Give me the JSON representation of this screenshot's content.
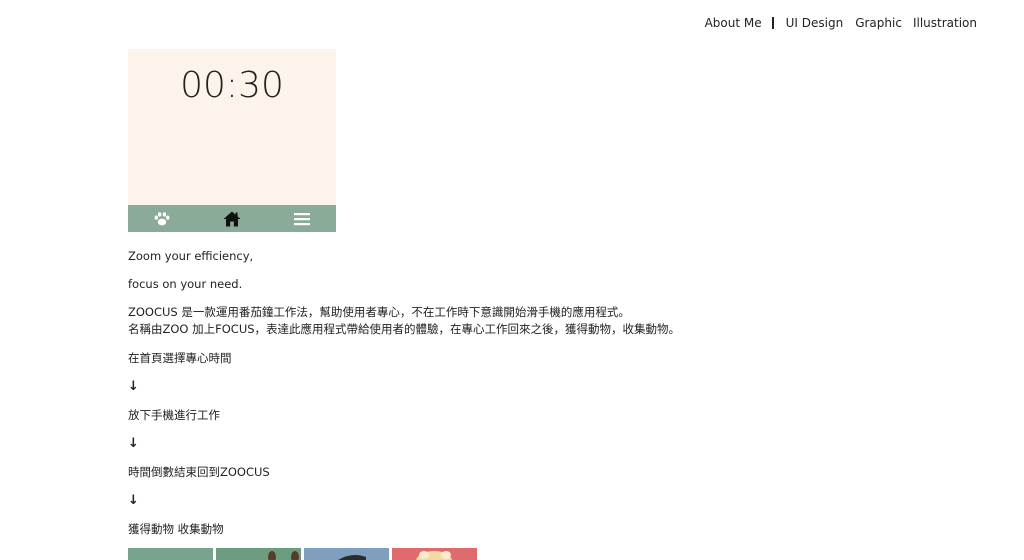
{
  "nav": {
    "items": [
      {
        "label": "About Me"
      },
      {
        "label": "UI Design"
      },
      {
        "label": "Graphic"
      },
      {
        "label": "Illustration"
      }
    ]
  },
  "phone": {
    "timer": "00:30",
    "background": "#fcf4ea",
    "tabbar_color": "#8aab98",
    "tabs": [
      {
        "icon": "paw-icon"
      },
      {
        "icon": "home-icon"
      },
      {
        "icon": "menu-icon"
      }
    ]
  },
  "content": {
    "tagline_1": "Zoom your efficiency,",
    "tagline_2": "focus on your need.",
    "description_1": "ZOOCUS 是一款運用番茄鐘工作法，幫助使用者專心，不在工作時下意識開始滑手機的應用程式。",
    "description_2": "名稱由ZOO 加上FOCUS，表達此應用程式帶給使用者的體驗，在專心工作回來之後，獲得動物，收集動物。",
    "steps": [
      "在首頁選擇專心時間",
      "放下手機進行工作",
      "時間倒數結束回到ZOOCUS",
      "獲得動物 收集動物"
    ],
    "arrow": "↓"
  },
  "thumbnails": {
    "colors": [
      "#78a48e",
      "#6d9d80",
      "#7f9fbf",
      "#e06b6e"
    ]
  }
}
